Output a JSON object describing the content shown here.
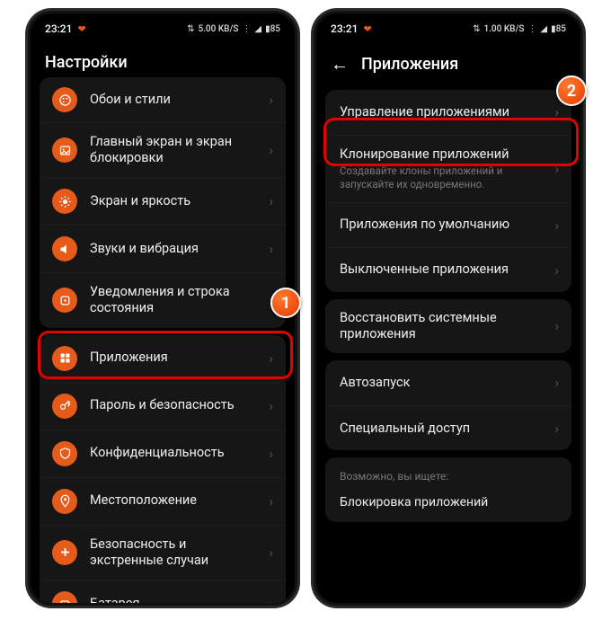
{
  "status": {
    "time": "23:21",
    "speed": "5.00",
    "speed_unit": "KB/S",
    "battery": "85"
  },
  "left": {
    "title": "Настройки",
    "items": [
      {
        "icon": "palette",
        "label": "Обои и стили"
      },
      {
        "icon": "image",
        "label": "Главный экран и экран блокировки"
      },
      {
        "icon": "sun",
        "label": "Экран и яркость"
      },
      {
        "icon": "volume",
        "label": "Звуки и вибрация"
      },
      {
        "icon": "camera",
        "label": "Уведомления и строка состояния"
      }
    ],
    "items2": [
      {
        "icon": "apps",
        "label": "Приложения"
      },
      {
        "icon": "key",
        "label": "Пароль и безопасность"
      },
      {
        "icon": "shield",
        "label": "Конфиденциальность"
      },
      {
        "icon": "pin",
        "label": "Местоположение"
      },
      {
        "icon": "medkit",
        "label": "Безопасность и экстренные случаи"
      },
      {
        "icon": "battery",
        "label": "Батарея"
      }
    ]
  },
  "right": {
    "title": "Приложения",
    "group1": [
      {
        "label": "Управление приложениями"
      },
      {
        "label": "Клонирование приложений",
        "sub": "Создавайте клоны приложений и запускайте их одновременно."
      },
      {
        "label": "Приложения по умолчанию"
      },
      {
        "label": "Выключенные приложения"
      }
    ],
    "group2": [
      {
        "label": "Восстановить системные приложения"
      }
    ],
    "group3": [
      {
        "label": "Автозапуск"
      },
      {
        "label": "Специальный доступ"
      }
    ],
    "hint_label": "Возможно, вы ищете:",
    "hint_item": "Блокировка приложений"
  },
  "status2": {
    "time": "23:21",
    "speed": "1.00",
    "speed_unit": "KB/S",
    "battery": "85"
  },
  "callouts": {
    "one": "1",
    "two": "2"
  }
}
